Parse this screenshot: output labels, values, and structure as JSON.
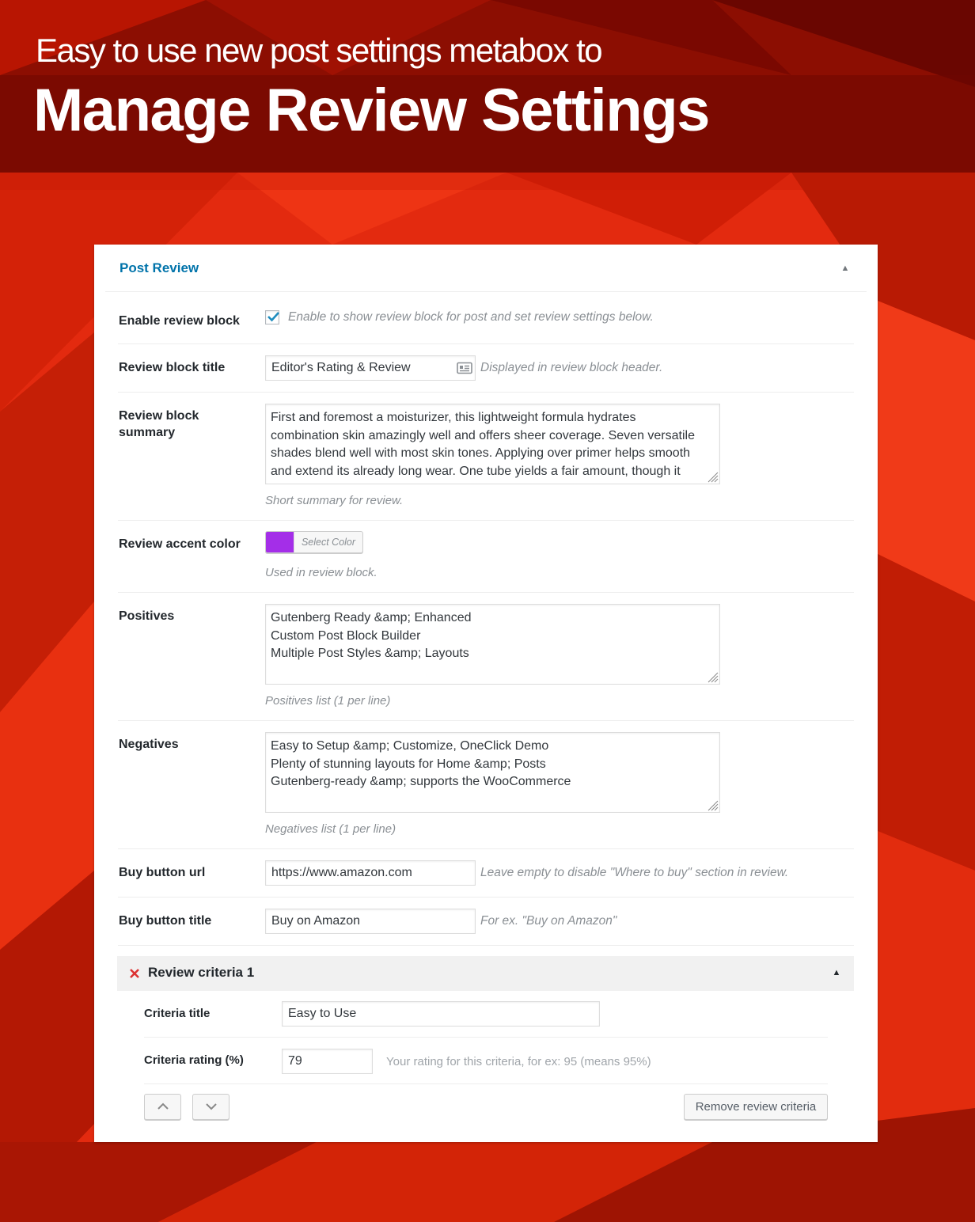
{
  "banner": {
    "subtitle": "Easy to use new post settings metabox to",
    "title": "Manage Review Settings"
  },
  "metabox": {
    "title": "Post Review",
    "toggle_icon": "triangle-up-icon",
    "fields": {
      "enable": {
        "label": "Enable review block",
        "checked": true,
        "description": "Enable to show review block for post and set review settings below."
      },
      "title": {
        "label": "Review block title",
        "value": "Editor's Rating & Review",
        "icon": "id-card-icon",
        "description": "Displayed in review block header."
      },
      "summary": {
        "label": "Review block summary",
        "lines": [
          "First and foremost a moisturizer, this lightweight formula hydrates",
          "combination skin amazingly well and offers sheer coverage. Seven versatile",
          "shades blend well with most skin tones. Applying over primer helps smooth",
          "and extend its already long wear. One tube yields a fair amount, though it"
        ],
        "description": "Short summary for review."
      },
      "accent": {
        "label": "Review accent color",
        "color": "#a42ee8",
        "button_label": "Select Color",
        "description": "Used in review block."
      },
      "positives": {
        "label": "Positives",
        "lines": [
          "Gutenberg Ready &amp; Enhanced",
          "Custom Post Block Builder",
          "Multiple Post Styles &amp; Layouts"
        ],
        "description": "Positives list (1 per line)"
      },
      "negatives": {
        "label": "Negatives",
        "lines": [
          "Easy to Setup &amp; Customize, OneClick Demo",
          "Plenty of stunning layouts for Home &amp; Posts",
          "Gutenberg-ready &amp; supports the WooCommerce"
        ],
        "description": "Negatives list (1 per line)"
      },
      "buy_url": {
        "label": "Buy button url",
        "value": "https://www.amazon.com",
        "description": "Leave empty to disable \"Where to buy\" section in review."
      },
      "buy_title": {
        "label": "Buy button title",
        "value": "Buy on Amazon",
        "description": "For ex. \"Buy on Amazon\""
      }
    },
    "criteria": {
      "title": "Review criteria 1",
      "remove_icon": "close-x-icon",
      "toggle_icon": "triangle-up-icon",
      "criteria_title": {
        "label": "Criteria title",
        "value": "Easy to Use"
      },
      "criteria_rating": {
        "label": "Criteria rating (%)",
        "value": "79",
        "description": "Your rating for this criteria, for ex: 95 (means 95%)"
      },
      "move_up_icon": "chevron-up-icon",
      "move_down_icon": "chevron-down-icon",
      "remove_button": "Remove review criteria"
    }
  },
  "colors": {
    "accent_link": "#0073aa",
    "background_red": "#e32a0f",
    "banner_dark_red": "#7d0a00",
    "remove_red": "#dc3232"
  }
}
